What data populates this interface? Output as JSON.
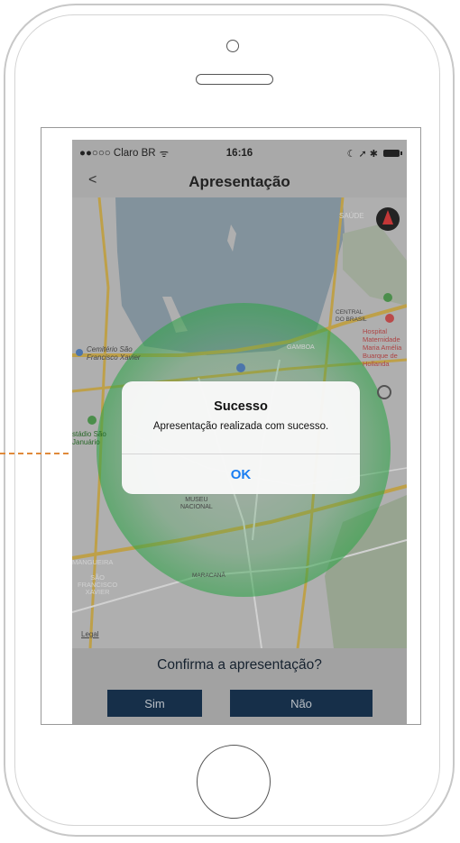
{
  "status": {
    "carrier": "●●○○○ Claro BR",
    "wifi": "ᯤ",
    "time": "16:16",
    "right_icons": "☾ ➚ ✱"
  },
  "nav": {
    "back": "<",
    "title": "Apresentação"
  },
  "map": {
    "labels": {
      "saude": "SAÚDE",
      "central": "CENTRAL\nDO BRASIL",
      "gamboa": "GAMBOA",
      "hospital": "Hospital\nMaternidade\nMaria Amélia\nBuarque de\nHollanda",
      "cemiterio": "Cemitério São\nFrancisco Xavier",
      "estadio": "stádio São\nJanuário",
      "museu": "MUSEU\nNACIONAL",
      "mangueira": "MANGUEIRA",
      "sao_francisco": "SÃO\nFRANCISCO\nXAVIER",
      "maracana": "MARACANÃ",
      "legal": "Legal"
    },
    "colors": {
      "water": "#9fb2bf",
      "land": "#d6d6d6",
      "park": "#b9c9b0",
      "road": "#e8c45a",
      "circle": "#3cc85a"
    }
  },
  "alert": {
    "title": "Sucesso",
    "message": "Apresentação realizada com sucesso.",
    "ok": "OK"
  },
  "confirm": {
    "question": "Confirma a apresentação?",
    "yes": "Sim",
    "no": "Não"
  }
}
